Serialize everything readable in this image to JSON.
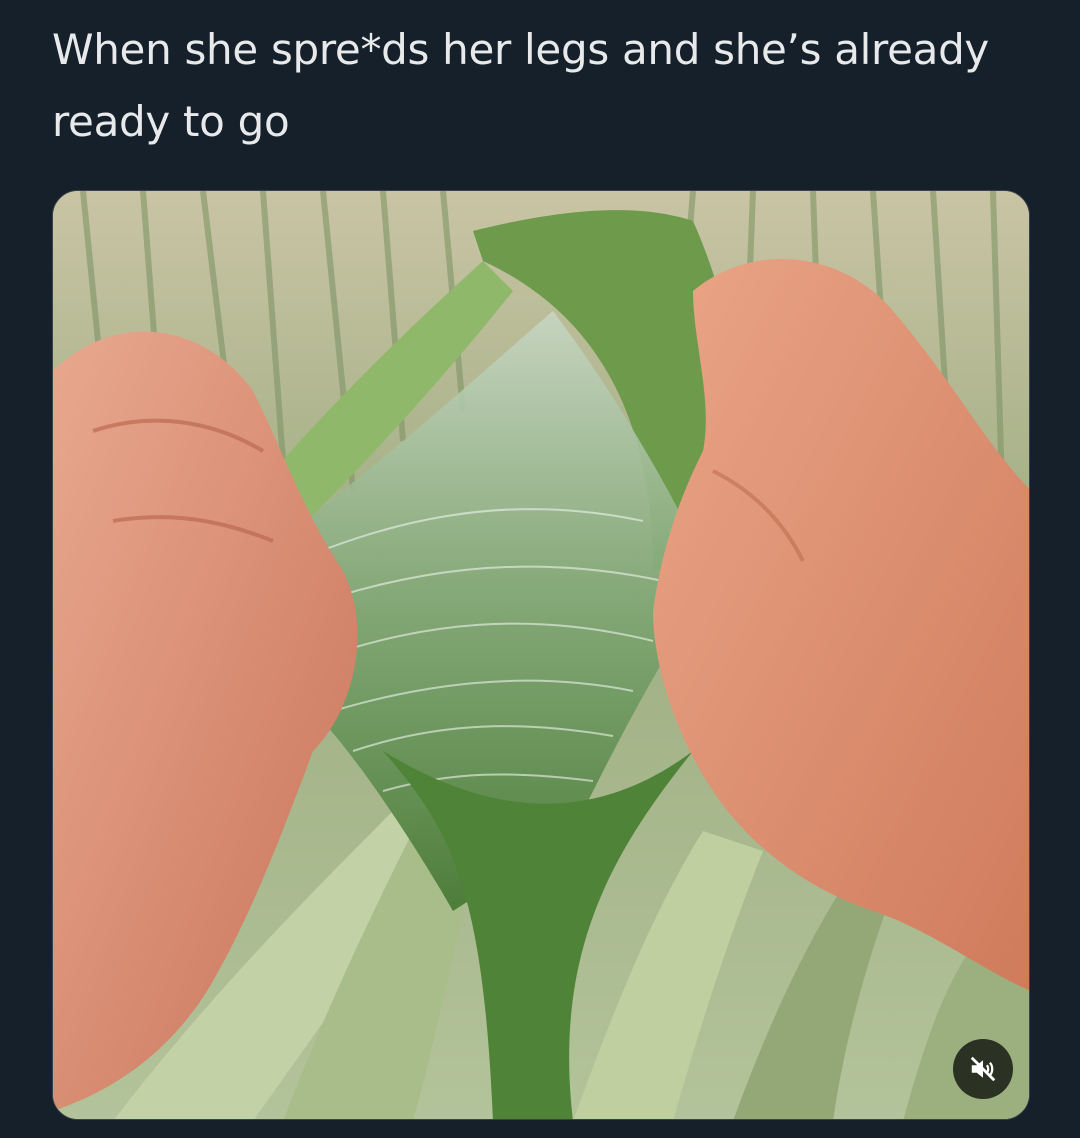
{
  "post": {
    "text": "When she spre*ds her legs and she’s already ready to go"
  },
  "media": {
    "type": "video",
    "muted": true,
    "icon": "speaker-muted-icon"
  },
  "colors": {
    "background": "#15202b",
    "text": "#e7e9ea",
    "leaf_green": "#5f8f3f",
    "skin": "#d9876a"
  }
}
